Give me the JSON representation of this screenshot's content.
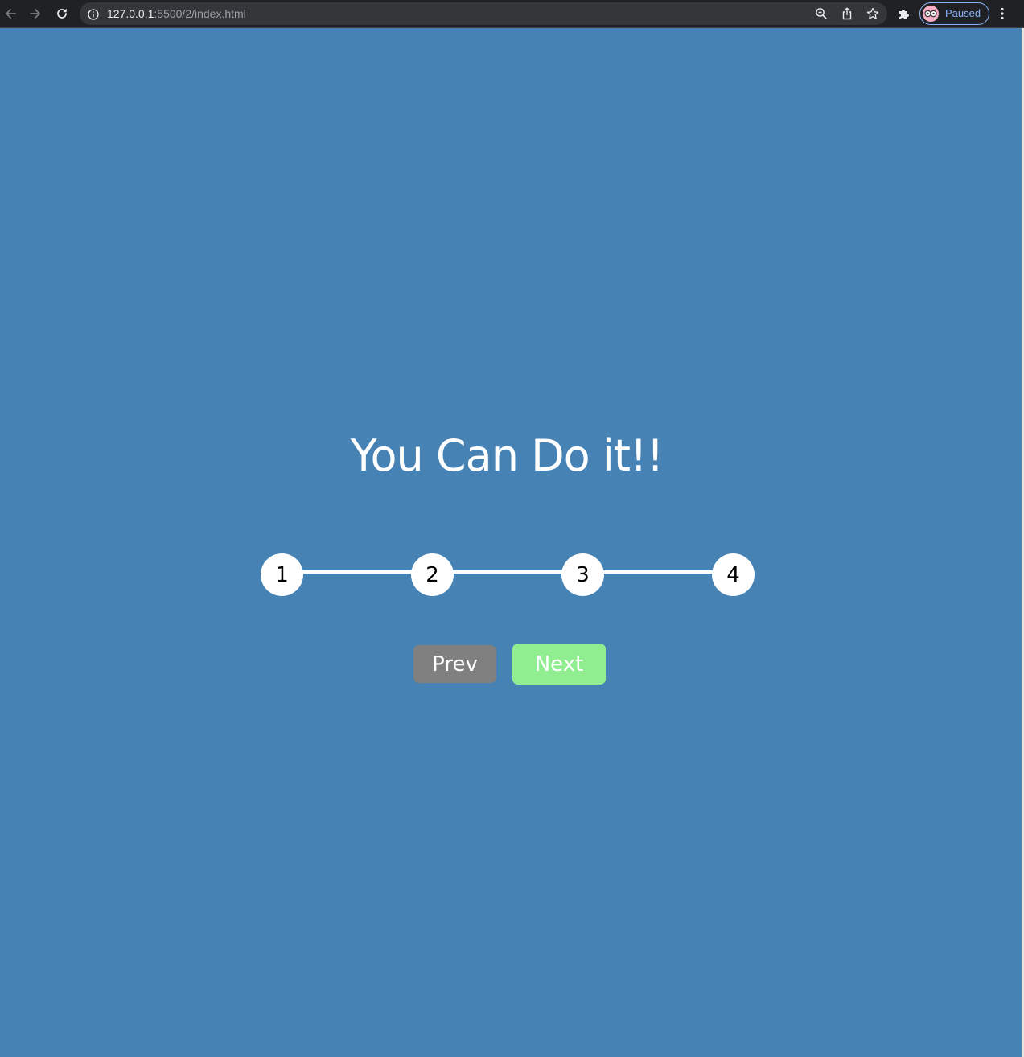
{
  "browser": {
    "url_host": "127.0.0.1",
    "url_path": ":5500/2/index.html",
    "profile_label": "Paused",
    "icons": {
      "back": "back-arrow-icon",
      "forward": "forward-arrow-icon",
      "reload": "reload-icon",
      "site_info": "info-icon",
      "zoom": "zoom-icon",
      "share": "share-icon",
      "bookmark": "star-icon",
      "extensions": "puzzle-icon",
      "menu": "kebab-menu-icon"
    }
  },
  "page": {
    "background": "#4682b4",
    "heading": "You Can Do it!!",
    "progress": {
      "steps": [
        "1",
        "2",
        "3",
        "4"
      ],
      "active_step": 1,
      "fill_fraction": 0.015,
      "fill_color": "#90ee90",
      "track_color": "#ffffff"
    },
    "buttons": {
      "prev_label": "Prev",
      "prev_color": "#808080",
      "next_label": "Next",
      "next_color": "#90ee90"
    }
  }
}
